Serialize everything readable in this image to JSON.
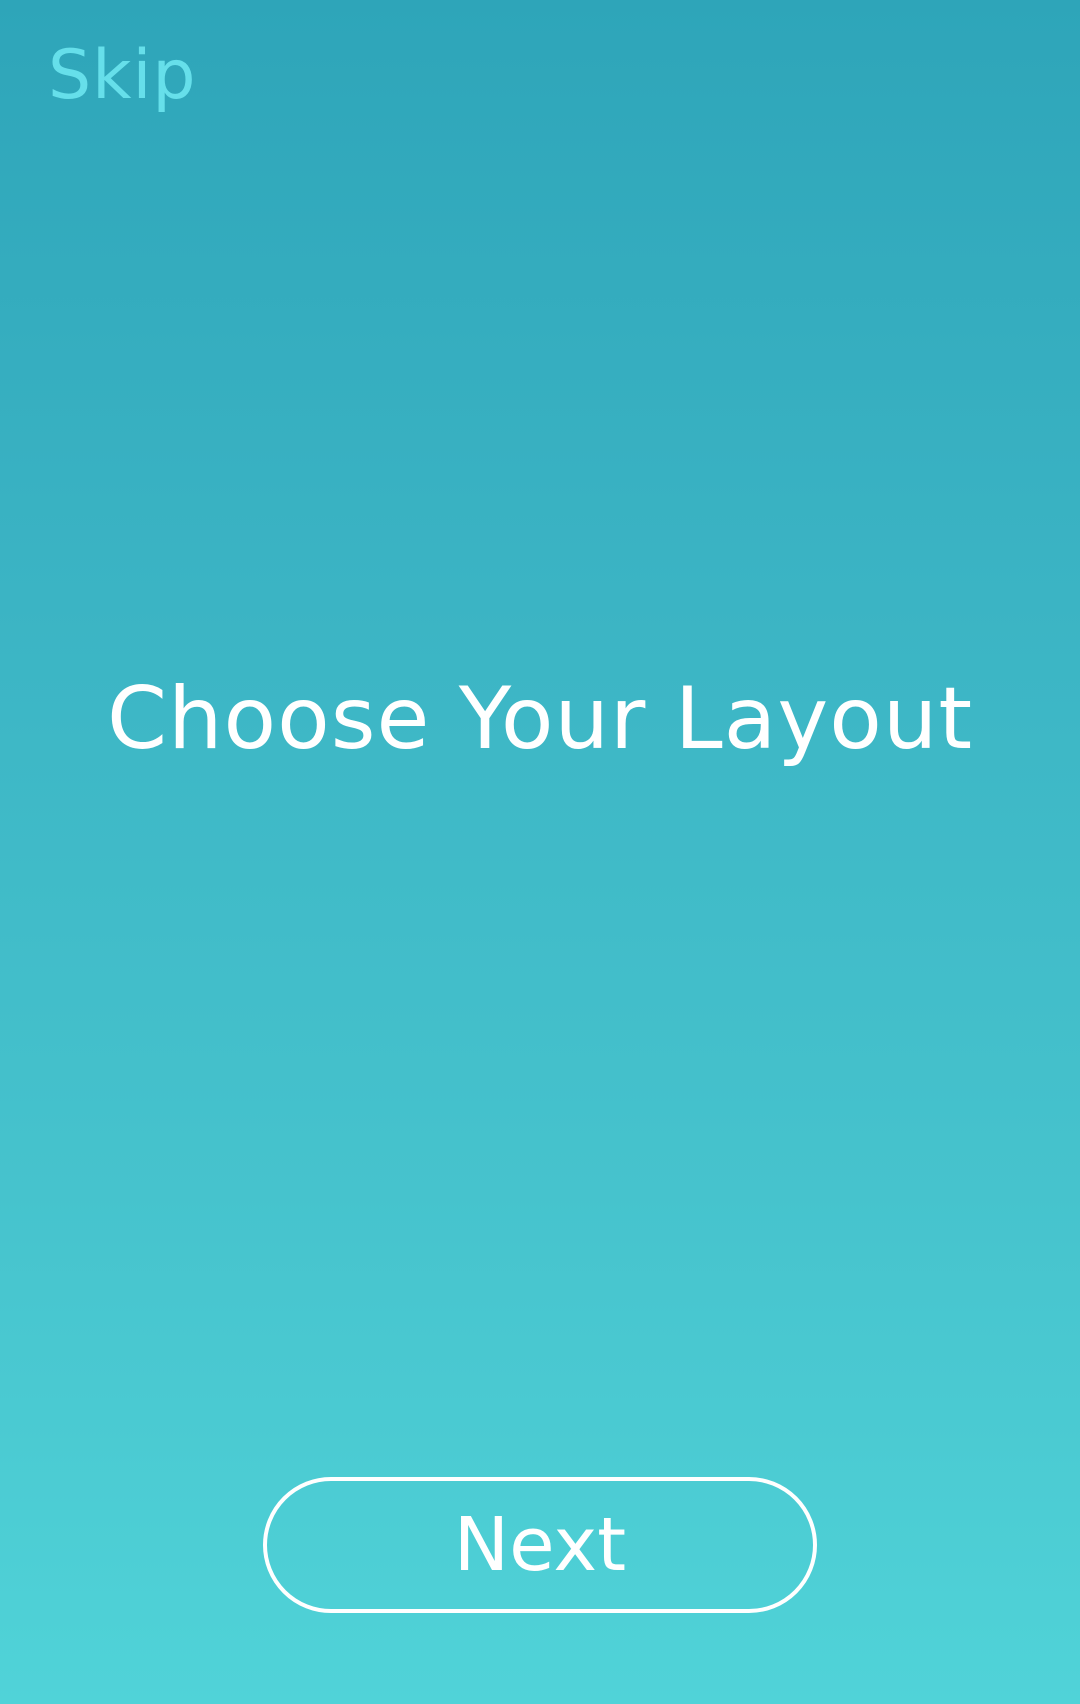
{
  "screen": {
    "skip_label": "Skip",
    "title": "Choose Your Layout",
    "next_label": "Next"
  },
  "colors": {
    "background_top": "#2ea5b9",
    "background_bottom": "#50d3d8",
    "skip_text": "#66dfea",
    "primary_text": "#ffffff",
    "button_border": "#ffffff"
  }
}
